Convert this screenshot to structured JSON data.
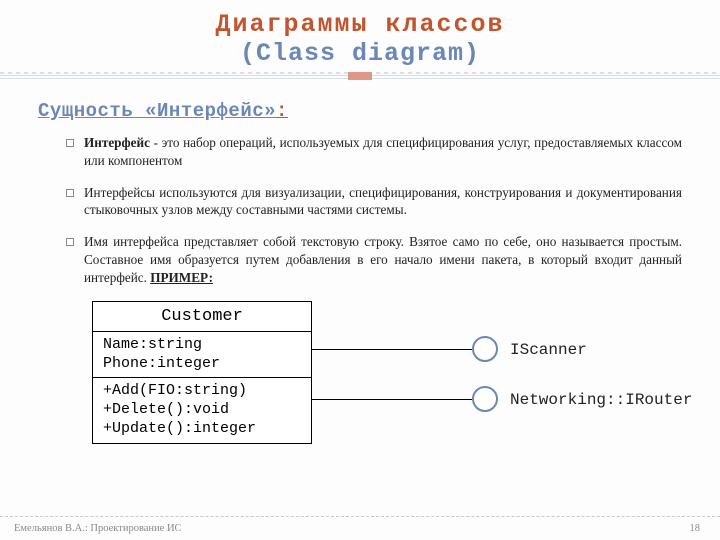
{
  "title": {
    "line1": "Диаграммы классов",
    "line2": "(Class diagram)"
  },
  "subhead": {
    "text": "Сущность «Интерфейс»",
    "colon": ":"
  },
  "bullets": {
    "b1_bold": "Интерфейс",
    "b1_rest": " - это набор операций, используемых для специфицирования услуг, предоставляемых классом или компонентом",
    "b2": "Интерфейсы используются для визуализации, специфицирования, конструирования и документирования стыковочных узлов между составными частями системы.",
    "b3_main": "Имя интерфейса представляет собой текстовую строку. Взятое само по себе, оно называется простым. Составное имя образуется путем добавления в его начало имени пакета, в который входит данный интерфейс. ",
    "b3_label": "ПРИМЕР:"
  },
  "uml": {
    "name": "Customer",
    "attr1": "Name:string",
    "attr2": "Phone:integer",
    "op1": "+Add(FIO:string)",
    "op2": "+Delete():void",
    "op3": "+Update():integer"
  },
  "iface": {
    "simple": "IScanner",
    "compound": "Networking::IRouter"
  },
  "footer": {
    "left": "Емельянов В.А.: Проектирование ИС",
    "page": "18"
  }
}
